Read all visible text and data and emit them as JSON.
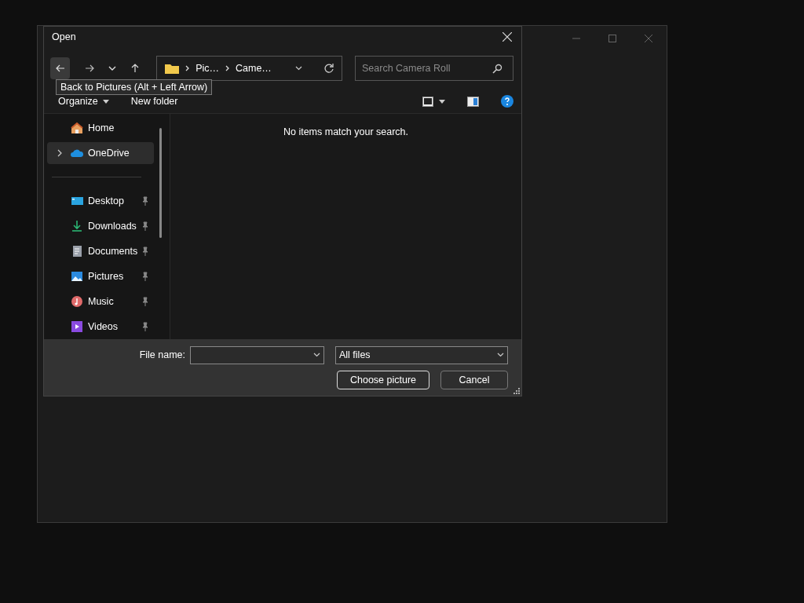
{
  "dialog": {
    "title": "Open",
    "tooltip": "Back to Pictures (Alt + Left Arrow)",
    "breadcrumb": [
      "Pic…",
      "Came…"
    ],
    "search": {
      "placeholder": "Search Camera Roll"
    },
    "commands": [
      "Organize",
      "New folder"
    ],
    "sidebar": {
      "items": [
        {
          "label": "Home",
          "kind": "home",
          "selected": false,
          "pinned": false
        },
        {
          "label": "OneDrive",
          "kind": "cloud",
          "selected": true,
          "pinned": false
        },
        {
          "label": "Desktop",
          "kind": "desktop",
          "selected": false,
          "pinned": true
        },
        {
          "label": "Downloads",
          "kind": "download",
          "selected": false,
          "pinned": true
        },
        {
          "label": "Documents",
          "kind": "documents",
          "selected": false,
          "pinned": true
        },
        {
          "label": "Pictures",
          "kind": "pictures",
          "selected": false,
          "pinned": true
        },
        {
          "label": "Music",
          "kind": "music",
          "selected": false,
          "pinned": true
        },
        {
          "label": "Videos",
          "kind": "videos",
          "selected": false,
          "pinned": true
        }
      ]
    },
    "message": "No items match your search.",
    "file_name": {
      "label": "File name:"
    },
    "file_type": {
      "value": "All files"
    },
    "buttons": [
      "Choose picture",
      "Cancel"
    ]
  }
}
